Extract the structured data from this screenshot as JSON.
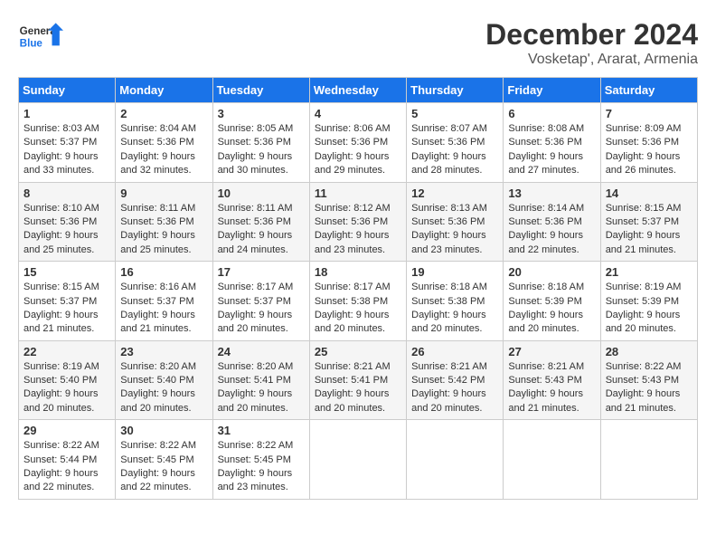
{
  "header": {
    "logo_general": "General",
    "logo_blue": "Blue",
    "month_title": "December 2024",
    "location": "Vosketap', Ararat, Armenia"
  },
  "days_of_week": [
    "Sunday",
    "Monday",
    "Tuesday",
    "Wednesday",
    "Thursday",
    "Friday",
    "Saturday"
  ],
  "weeks": [
    [
      {
        "day": "1",
        "sunrise": "8:03 AM",
        "sunset": "5:37 PM",
        "daylight": "9 hours and 33 minutes."
      },
      {
        "day": "2",
        "sunrise": "8:04 AM",
        "sunset": "5:36 PM",
        "daylight": "9 hours and 32 minutes."
      },
      {
        "day": "3",
        "sunrise": "8:05 AM",
        "sunset": "5:36 PM",
        "daylight": "9 hours and 30 minutes."
      },
      {
        "day": "4",
        "sunrise": "8:06 AM",
        "sunset": "5:36 PM",
        "daylight": "9 hours and 29 minutes."
      },
      {
        "day": "5",
        "sunrise": "8:07 AM",
        "sunset": "5:36 PM",
        "daylight": "9 hours and 28 minutes."
      },
      {
        "day": "6",
        "sunrise": "8:08 AM",
        "sunset": "5:36 PM",
        "daylight": "9 hours and 27 minutes."
      },
      {
        "day": "7",
        "sunrise": "8:09 AM",
        "sunset": "5:36 PM",
        "daylight": "9 hours and 26 minutes."
      }
    ],
    [
      {
        "day": "8",
        "sunrise": "8:10 AM",
        "sunset": "5:36 PM",
        "daylight": "9 hours and 25 minutes."
      },
      {
        "day": "9",
        "sunrise": "8:11 AM",
        "sunset": "5:36 PM",
        "daylight": "9 hours and 25 minutes."
      },
      {
        "day": "10",
        "sunrise": "8:11 AM",
        "sunset": "5:36 PM",
        "daylight": "9 hours and 24 minutes."
      },
      {
        "day": "11",
        "sunrise": "8:12 AM",
        "sunset": "5:36 PM",
        "daylight": "9 hours and 23 minutes."
      },
      {
        "day": "12",
        "sunrise": "8:13 AM",
        "sunset": "5:36 PM",
        "daylight": "9 hours and 23 minutes."
      },
      {
        "day": "13",
        "sunrise": "8:14 AM",
        "sunset": "5:36 PM",
        "daylight": "9 hours and 22 minutes."
      },
      {
        "day": "14",
        "sunrise": "8:15 AM",
        "sunset": "5:37 PM",
        "daylight": "9 hours and 21 minutes."
      }
    ],
    [
      {
        "day": "15",
        "sunrise": "8:15 AM",
        "sunset": "5:37 PM",
        "daylight": "9 hours and 21 minutes."
      },
      {
        "day": "16",
        "sunrise": "8:16 AM",
        "sunset": "5:37 PM",
        "daylight": "9 hours and 21 minutes."
      },
      {
        "day": "17",
        "sunrise": "8:17 AM",
        "sunset": "5:37 PM",
        "daylight": "9 hours and 20 minutes."
      },
      {
        "day": "18",
        "sunrise": "8:17 AM",
        "sunset": "5:38 PM",
        "daylight": "9 hours and 20 minutes."
      },
      {
        "day": "19",
        "sunrise": "8:18 AM",
        "sunset": "5:38 PM",
        "daylight": "9 hours and 20 minutes."
      },
      {
        "day": "20",
        "sunrise": "8:18 AM",
        "sunset": "5:39 PM",
        "daylight": "9 hours and 20 minutes."
      },
      {
        "day": "21",
        "sunrise": "8:19 AM",
        "sunset": "5:39 PM",
        "daylight": "9 hours and 20 minutes."
      }
    ],
    [
      {
        "day": "22",
        "sunrise": "8:19 AM",
        "sunset": "5:40 PM",
        "daylight": "9 hours and 20 minutes."
      },
      {
        "day": "23",
        "sunrise": "8:20 AM",
        "sunset": "5:40 PM",
        "daylight": "9 hours and 20 minutes."
      },
      {
        "day": "24",
        "sunrise": "8:20 AM",
        "sunset": "5:41 PM",
        "daylight": "9 hours and 20 minutes."
      },
      {
        "day": "25",
        "sunrise": "8:21 AM",
        "sunset": "5:41 PM",
        "daylight": "9 hours and 20 minutes."
      },
      {
        "day": "26",
        "sunrise": "8:21 AM",
        "sunset": "5:42 PM",
        "daylight": "9 hours and 20 minutes."
      },
      {
        "day": "27",
        "sunrise": "8:21 AM",
        "sunset": "5:43 PM",
        "daylight": "9 hours and 21 minutes."
      },
      {
        "day": "28",
        "sunrise": "8:22 AM",
        "sunset": "5:43 PM",
        "daylight": "9 hours and 21 minutes."
      }
    ],
    [
      {
        "day": "29",
        "sunrise": "8:22 AM",
        "sunset": "5:44 PM",
        "daylight": "9 hours and 22 minutes."
      },
      {
        "day": "30",
        "sunrise": "8:22 AM",
        "sunset": "5:45 PM",
        "daylight": "9 hours and 22 minutes."
      },
      {
        "day": "31",
        "sunrise": "8:22 AM",
        "sunset": "5:45 PM",
        "daylight": "9 hours and 23 minutes."
      },
      null,
      null,
      null,
      null
    ]
  ]
}
